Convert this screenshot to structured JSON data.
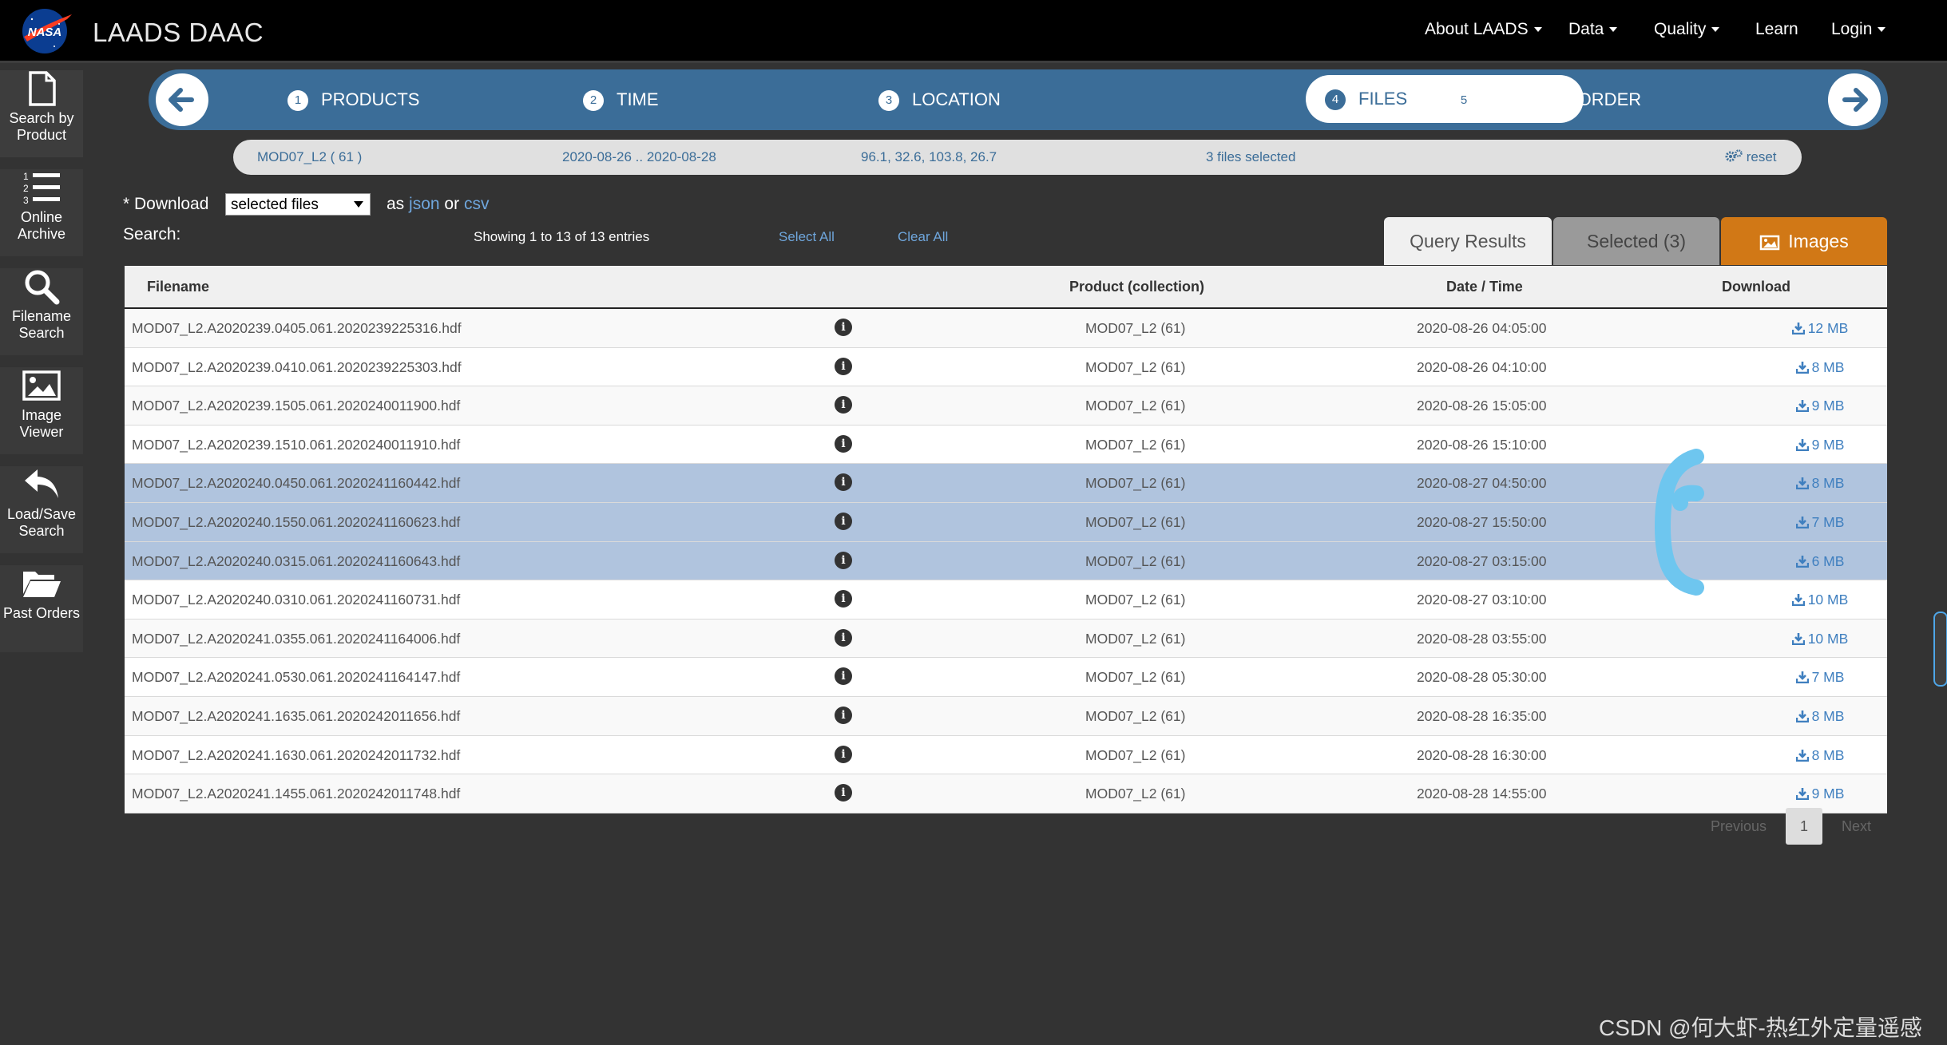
{
  "app": {
    "title": "LAADS DAAC",
    "logo_text": "NASA"
  },
  "nav": [
    {
      "label": "About LAADS",
      "has_caret": true
    },
    {
      "label": "Data",
      "has_caret": true
    },
    {
      "label": "Quality",
      "has_caret": true
    },
    {
      "label": "Learn",
      "has_caret": false
    },
    {
      "label": "Login",
      "has_caret": true
    }
  ],
  "sidebar": [
    {
      "icon": "file-icon",
      "line1": "Search by",
      "line2": "Product"
    },
    {
      "icon": "list-icon",
      "line1": "Online",
      "line2": "Archive"
    },
    {
      "icon": "search-icon",
      "line1": "Filename",
      "line2": "Search"
    },
    {
      "icon": "image-icon",
      "line1": "Image",
      "line2": "Viewer"
    },
    {
      "icon": "reply-icon",
      "line1": "Load/Save",
      "line2": "Search"
    },
    {
      "icon": "folder-icon",
      "line1": "Past Orders",
      "line2": ""
    }
  ],
  "wizard": {
    "steps": [
      {
        "num": "1",
        "label": "PRODUCTS"
      },
      {
        "num": "2",
        "label": "TIME"
      },
      {
        "num": "3",
        "label": "LOCATION"
      },
      {
        "num": "4",
        "label": "FILES"
      },
      {
        "num": "5",
        "label": "REVIEW & ORDER"
      }
    ],
    "active_step": 4
  },
  "summary": {
    "product": "MOD07_L2 ( 61 )",
    "dates": "2020-08-26 .. 2020-08-28",
    "location": "96.1, 32.6, 103.8, 26.7",
    "selection": "3 files selected",
    "reset": "reset"
  },
  "download": {
    "label": "* Download",
    "select_value": "selected files",
    "as": "as",
    "json": "json",
    "or": "or",
    "csv": "csv"
  },
  "search": {
    "label": "Search:",
    "showing": "Showing 1 to 13 of 13 entries",
    "select_all": "Select All",
    "clear_all": "Clear All"
  },
  "tabs": {
    "query": "Query Results",
    "selected": "Selected (3)",
    "images": "Images"
  },
  "table": {
    "headers": {
      "filename": "Filename",
      "product": "Product (collection)",
      "date": "Date / Time",
      "download": "Download"
    },
    "rows": [
      {
        "file": "MOD07_L2.A2020239.0405.061.2020239225316.hdf",
        "product": "MOD07_L2 (61)",
        "date": "2020-08-26 04:05:00",
        "size": "12 MB",
        "selected": false
      },
      {
        "file": "MOD07_L2.A2020239.0410.061.2020239225303.hdf",
        "product": "MOD07_L2 (61)",
        "date": "2020-08-26 04:10:00",
        "size": "8 MB",
        "selected": false
      },
      {
        "file": "MOD07_L2.A2020239.1505.061.2020240011900.hdf",
        "product": "MOD07_L2 (61)",
        "date": "2020-08-26 15:05:00",
        "size": "9 MB",
        "selected": false
      },
      {
        "file": "MOD07_L2.A2020239.1510.061.2020240011910.hdf",
        "product": "MOD07_L2 (61)",
        "date": "2020-08-26 15:10:00",
        "size": "9 MB",
        "selected": false
      },
      {
        "file": "MOD07_L2.A2020240.0450.061.2020241160442.hdf",
        "product": "MOD07_L2 (61)",
        "date": "2020-08-27 04:50:00",
        "size": "8 MB",
        "selected": true
      },
      {
        "file": "MOD07_L2.A2020240.1550.061.2020241160623.hdf",
        "product": "MOD07_L2 (61)",
        "date": "2020-08-27 15:50:00",
        "size": "7 MB",
        "selected": true
      },
      {
        "file": "MOD07_L2.A2020240.0315.061.2020241160643.hdf",
        "product": "MOD07_L2 (61)",
        "date": "2020-08-27 03:15:00",
        "size": "6 MB",
        "selected": true
      },
      {
        "file": "MOD07_L2.A2020240.0310.061.2020241160731.hdf",
        "product": "MOD07_L2 (61)",
        "date": "2020-08-27 03:10:00",
        "size": "10 MB",
        "selected": false
      },
      {
        "file": "MOD07_L2.A2020241.0355.061.2020241164006.hdf",
        "product": "MOD07_L2 (61)",
        "date": "2020-08-28 03:55:00",
        "size": "10 MB",
        "selected": false
      },
      {
        "file": "MOD07_L2.A2020241.0530.061.2020241164147.hdf",
        "product": "MOD07_L2 (61)",
        "date": "2020-08-28 05:30:00",
        "size": "7 MB",
        "selected": false
      },
      {
        "file": "MOD07_L2.A2020241.1635.061.2020242011656.hdf",
        "product": "MOD07_L2 (61)",
        "date": "2020-08-28 16:35:00",
        "size": "8 MB",
        "selected": false
      },
      {
        "file": "MOD07_L2.A2020241.1630.061.2020242011732.hdf",
        "product": "MOD07_L2 (61)",
        "date": "2020-08-28 16:30:00",
        "size": "8 MB",
        "selected": false
      },
      {
        "file": "MOD07_L2.A2020241.1455.061.2020242011748.hdf",
        "product": "MOD07_L2 (61)",
        "date": "2020-08-28 14:55:00",
        "size": "9 MB",
        "selected": false
      }
    ]
  },
  "pager": {
    "previous": "Previous",
    "page": "1",
    "next": "Next"
  },
  "watermark": "CSDN @何大虾-热红外定量遥感",
  "colors": {
    "accent": "#3b6d98",
    "images_tab": "#d17816",
    "selected_row": "#b0c4de",
    "link": "#3f7fbf",
    "annotation": "#6ec6ef"
  }
}
